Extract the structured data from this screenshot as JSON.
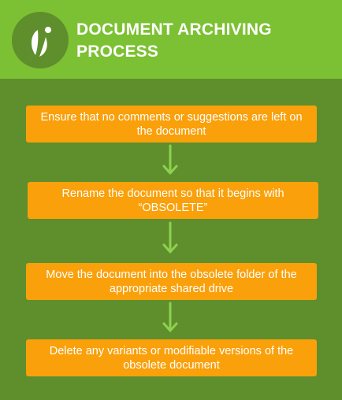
{
  "header": {
    "title": "DOCUMENT ARCHIVING PROCESS",
    "logo_icon": "leaf-person-logo-icon",
    "background_color": "#7cc133"
  },
  "steps": [
    {
      "label": "Ensure that no comments or suggestions are left on the document"
    },
    {
      "label": "Rename the document so that it begins with “OBSOLETE”"
    },
    {
      "label": "Move the document into the obsolete folder of the appropriate shared drive"
    },
    {
      "label": "Delete any variants or modifiable versions of the obsolete document"
    }
  ],
  "colors": {
    "page_background": "#5e8f2c",
    "step_fill": "#f9a00a",
    "arrow": "#8fd14f"
  }
}
